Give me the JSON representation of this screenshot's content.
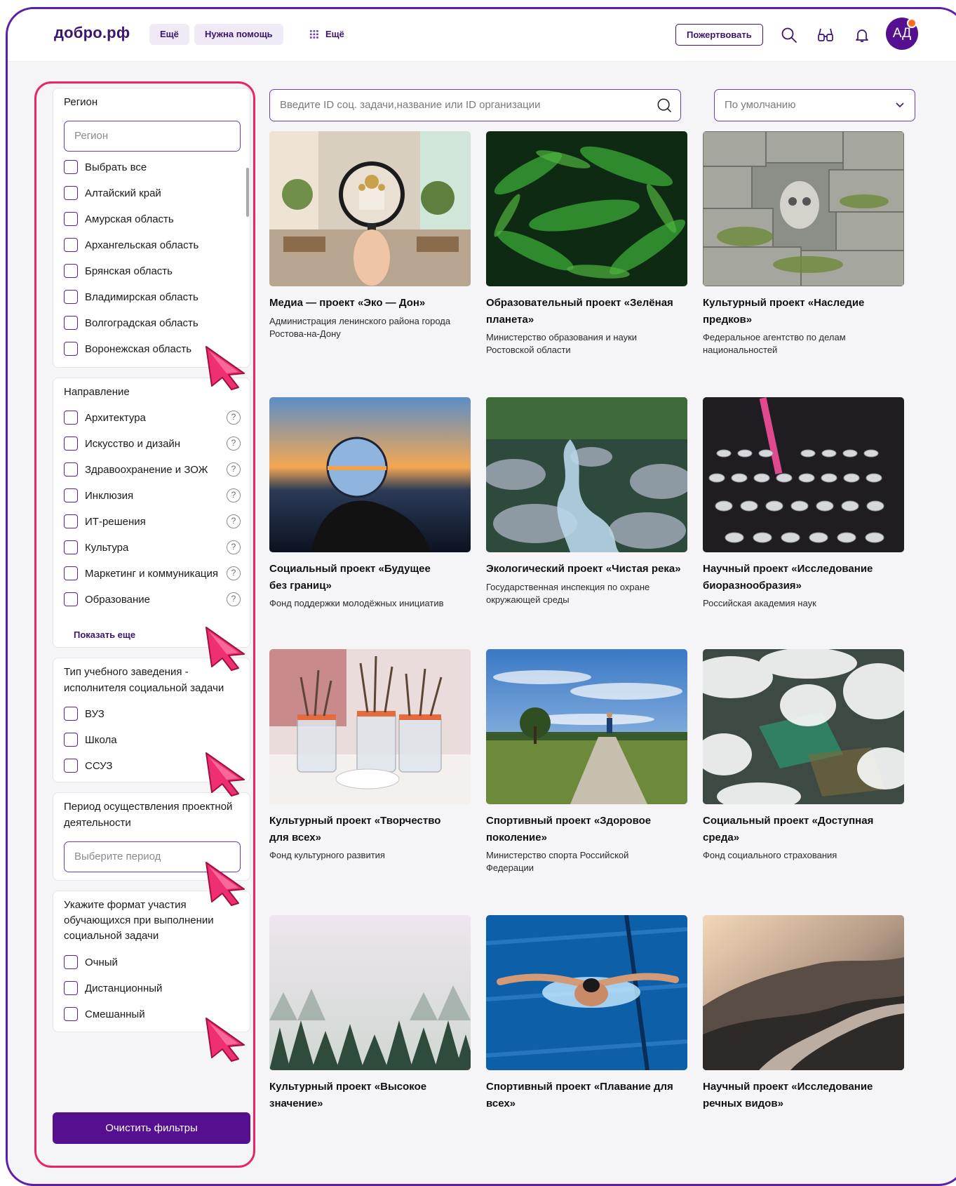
{
  "header": {
    "logo": "добро.рф",
    "nav_more_1": "Ещё",
    "nav_help": "Нужна помощь",
    "nav_more_2": "Ещё",
    "donate": "Пожертвовать",
    "avatar": "АД"
  },
  "filters": {
    "region": {
      "title": "Регион",
      "placeholder": "Регион",
      "items": [
        "Выбрать все",
        "Алтайский край",
        "Амурская область",
        "Архангельская область",
        "Брянская область",
        "Владимирская область",
        "Волгоградская область",
        "Воронежская область"
      ]
    },
    "direction": {
      "title": "Направление",
      "items": [
        "Архитектура",
        "Искусство и дизайн",
        "Здравоохранение и ЗОЖ",
        "Инклюзия",
        "ИТ-решения",
        "Культура",
        "Маркетинг и коммуникация",
        "Образование"
      ],
      "help_glyph": "?",
      "show_more": "Показать еще"
    },
    "institution": {
      "title_line1": "Тип учебного заведения -",
      "title_line2": "исполнителя социальной задачи",
      "items": [
        "ВУЗ",
        "Школа",
        "ССУЗ"
      ]
    },
    "period": {
      "title_line1": "Период осуществления проектной",
      "title_line2": "деятельности",
      "placeholder": "Выберите период"
    },
    "format": {
      "title_line1": "Укажите формат участия",
      "title_line2": "обучающихся при выполнении",
      "title_line3": "социальной задачи",
      "items": [
        "Очный",
        "Дистанционный",
        "Смешанный"
      ]
    },
    "clear_button": "Очистить фильтры"
  },
  "search": {
    "placeholder": "Введите ID соц. задачи,название или ID организации"
  },
  "sort": {
    "value": "По умолчанию"
  },
  "projects": [
    {
      "title_l1": "Медиа — проект «Эко — Дон»",
      "title_l2": "",
      "org_l1": "Администрация ленинского района города",
      "org_l2": "Ростова-на-Дону",
      "image": "street-magnifier-cathedral"
    },
    {
      "title_l1": "Образовательный проект «Зелёная",
      "title_l2": "планета»",
      "org_l1": "Министерство образования и науки",
      "org_l2": "Ростовской области",
      "image": "fern-leaves"
    },
    {
      "title_l1": "Культурный проект «Наследие",
      "title_l2": "предков»",
      "org_l1": "Федеральное агентство по делам",
      "org_l2": "национальностей",
      "image": "stone-wall-skull"
    },
    {
      "title_l1": "Социальный проект «Будущее",
      "title_l2": "без границ»",
      "org_l1": "Фонд поддержки молодёжных инициатив",
      "org_l2": "",
      "image": "crystal-ball-sunset"
    },
    {
      "title_l1": "Экологический проект «Чистая река»",
      "title_l2": "",
      "org_l1": "Государственная инспекция по охране",
      "org_l2": "окружающей среды",
      "image": "mountain-stream"
    },
    {
      "title_l1": "Научный проект «Исследование",
      "title_l2": "биоразнообразия»",
      "org_l1": "Российская академия наук",
      "org_l2": "",
      "image": "lab-test-tubes"
    },
    {
      "title_l1": "Культурный проект «Творчество",
      "title_l2": "для всех»",
      "org_l1": "Фонд культурного развития",
      "org_l2": "",
      "image": "paint-brushes"
    },
    {
      "title_l1": "Спортивный проект «Здоровое",
      "title_l2": "поколение»",
      "org_l1": "Министерство спорта Российской",
      "org_l2": "Федерации",
      "image": "runner-country-road"
    },
    {
      "title_l1": "Социальный проект «Доступная",
      "title_l2": "среда»",
      "org_l1": "Фонд социального страхования",
      "org_l2": "",
      "image": "aerial-clouds-fields"
    },
    {
      "title_l1": "Культурный проект «Высокое",
      "title_l2": "значение»",
      "org_l1": "",
      "org_l2": "",
      "image": "misty-forest"
    },
    {
      "title_l1": "Спортивный проект «Плавание для",
      "title_l2": "всех»",
      "org_l1": "",
      "org_l2": "",
      "image": "swimmer-pool"
    },
    {
      "title_l1": "Научный проект «Исследование",
      "title_l2": "речных видов»",
      "org_l1": "",
      "org_l2": "",
      "image": "river-valley-sunset"
    }
  ],
  "colors": {
    "brand": "#54108f",
    "accent": "#e8246a",
    "logo_dot": "#ff7a1a"
  }
}
